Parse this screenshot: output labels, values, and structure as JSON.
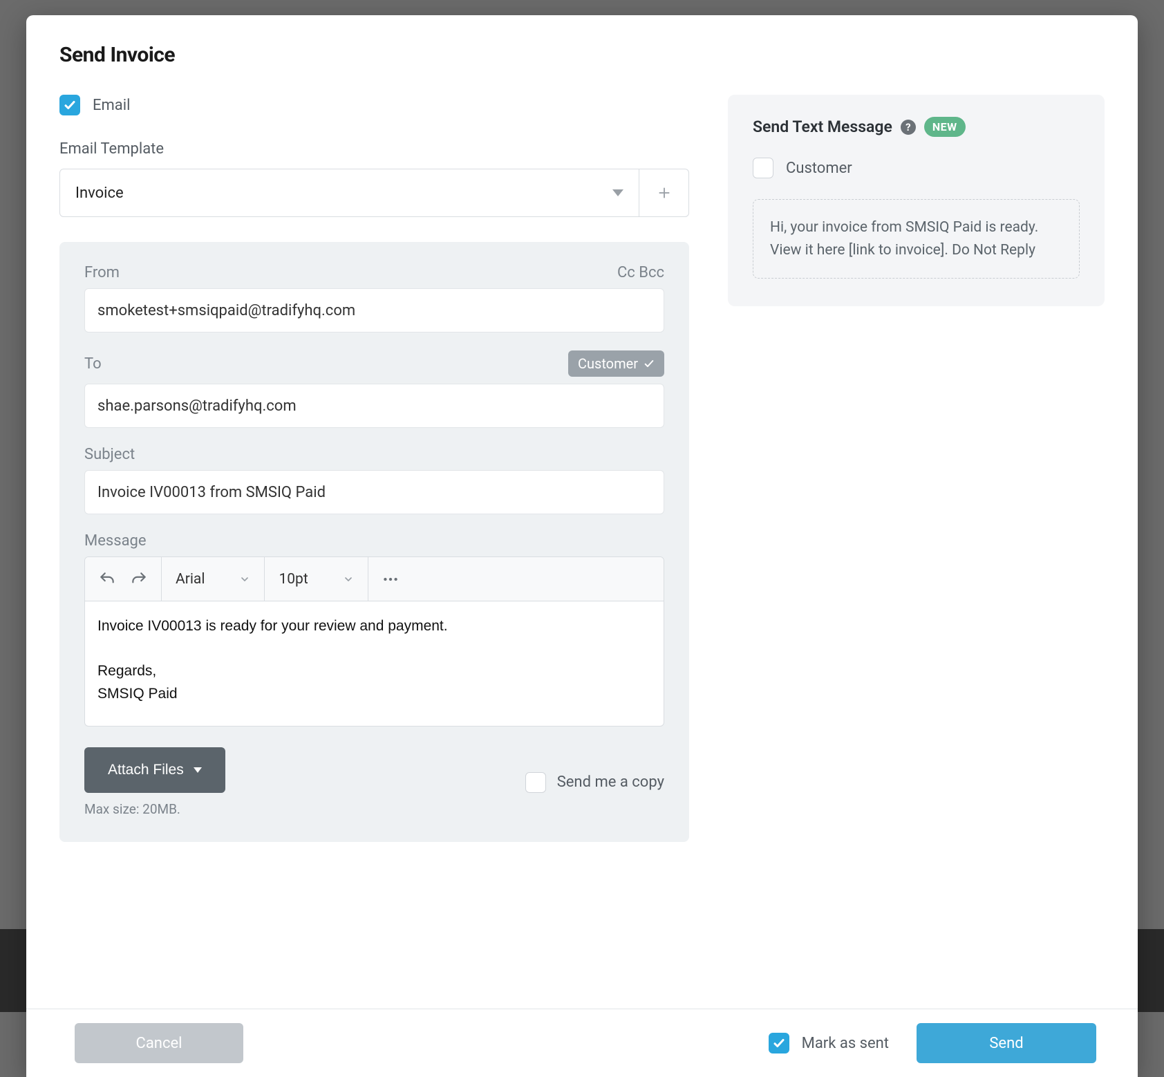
{
  "modal": {
    "title": "Send Invoice",
    "email_checkbox_label": "Email",
    "email_checkbox_checked": true,
    "template_label": "Email Template",
    "template_selected": "Invoice",
    "from_label": "From",
    "cc_label": "Cc",
    "bcc_label": "Bcc",
    "from_value": "smoketest+smsiqpaid@tradifyhq.com",
    "to_label": "To",
    "to_chip": "Customer",
    "to_value": "shae.parsons@tradifyhq.com",
    "subject_label": "Subject",
    "subject_value": "Invoice IV00013 from SMSIQ Paid",
    "message_label": "Message",
    "editor": {
      "font_family": "Arial",
      "font_size": "10pt",
      "body_line1": "Invoice IV00013 is ready for your review and payment.",
      "body_line2": "Regards,",
      "body_line3": "SMSIQ Paid"
    },
    "attach_label": "Attach Files",
    "max_size_hint": "Max size: 20MB.",
    "send_copy_label": "Send me a copy",
    "send_copy_checked": false
  },
  "sms": {
    "heading": "Send Text Message",
    "badge": "NEW",
    "customer_label": "Customer",
    "customer_checked": false,
    "body": "Hi, your invoice from SMSIQ Paid is ready. View it here [link to invoice]. Do Not Reply"
  },
  "footer": {
    "cancel": "Cancel",
    "mark_as_sent_label": "Mark as sent",
    "mark_as_sent_checked": true,
    "send": "Send"
  }
}
